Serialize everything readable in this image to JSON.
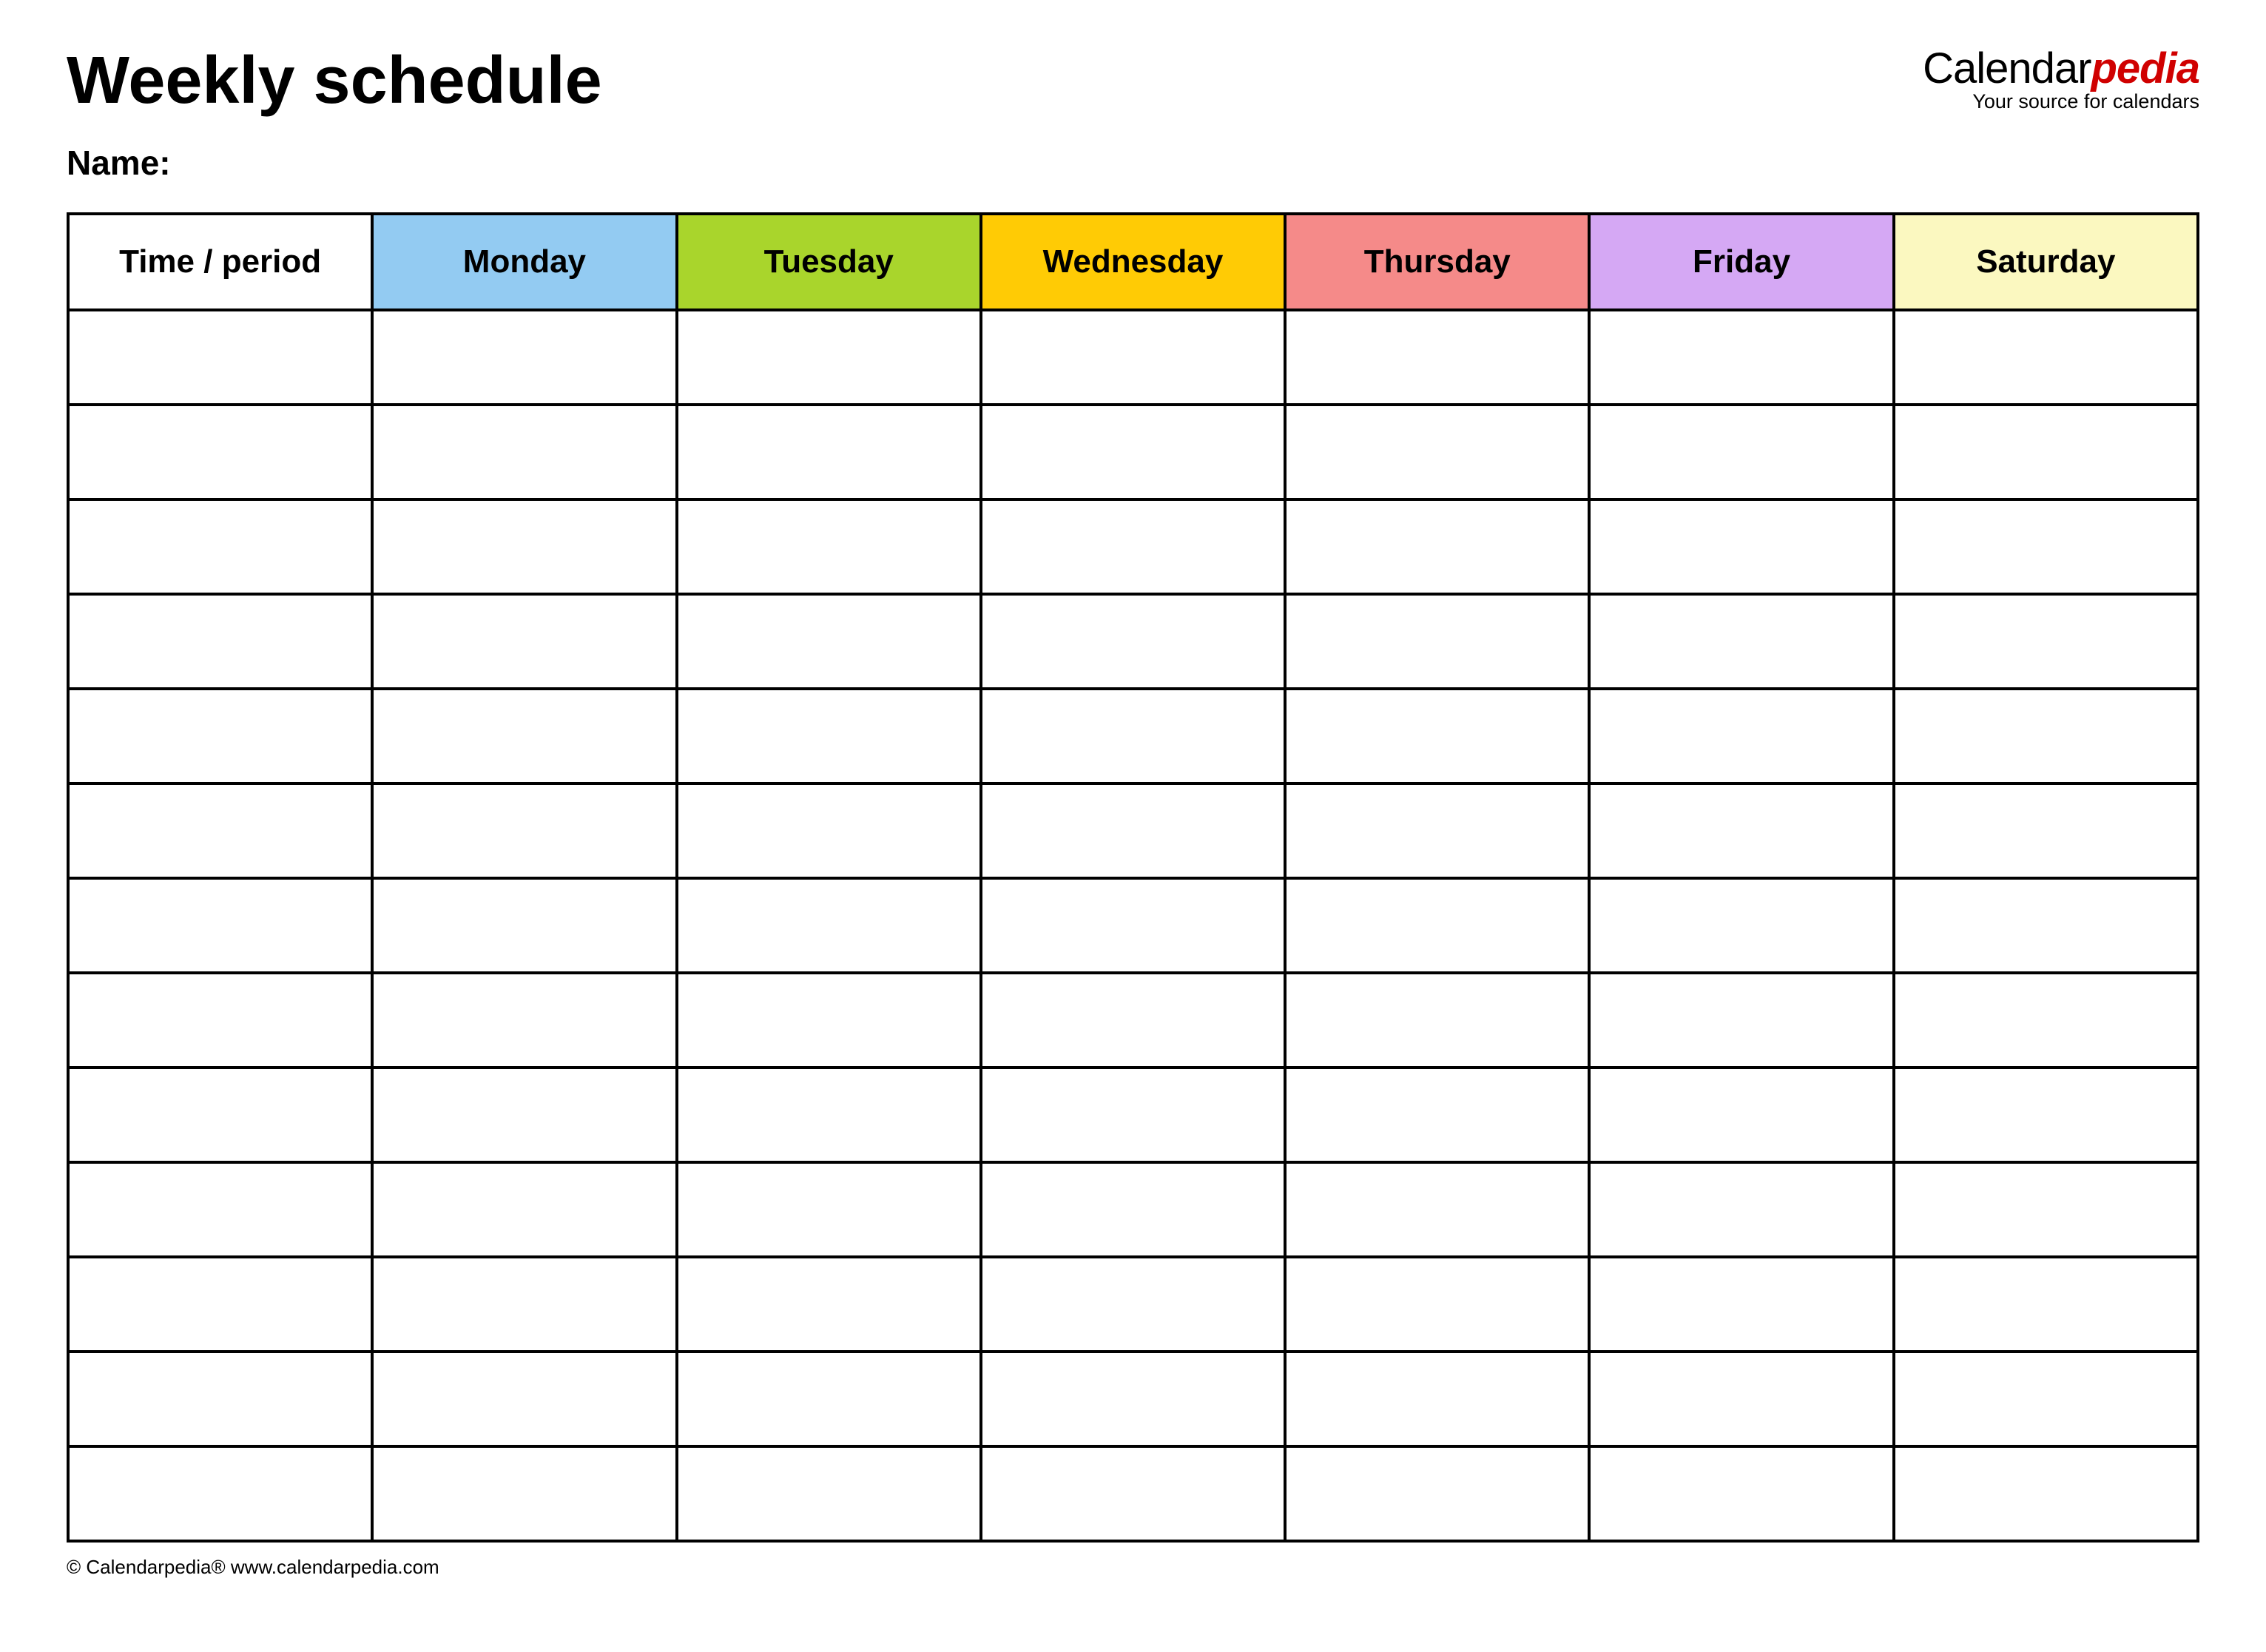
{
  "header": {
    "title": "Weekly schedule",
    "name_label": "Name:"
  },
  "logo": {
    "part1": "Calendar",
    "part2": "pedia",
    "tagline": "Your source for calendars"
  },
  "table": {
    "columns": [
      {
        "label": "Time / period",
        "color": "#ffffff"
      },
      {
        "label": "Monday",
        "color": "#93cbf2"
      },
      {
        "label": "Tuesday",
        "color": "#a9d52c"
      },
      {
        "label": "Wednesday",
        "color": "#ffcb05"
      },
      {
        "label": "Thursday",
        "color": "#f58a89"
      },
      {
        "label": "Friday",
        "color": "#d5a8f4"
      },
      {
        "label": "Saturday",
        "color": "#fbf8c0"
      }
    ],
    "row_count": 13
  },
  "footer": {
    "copyright": "© Calendarpedia®   www.calendarpedia.com"
  }
}
